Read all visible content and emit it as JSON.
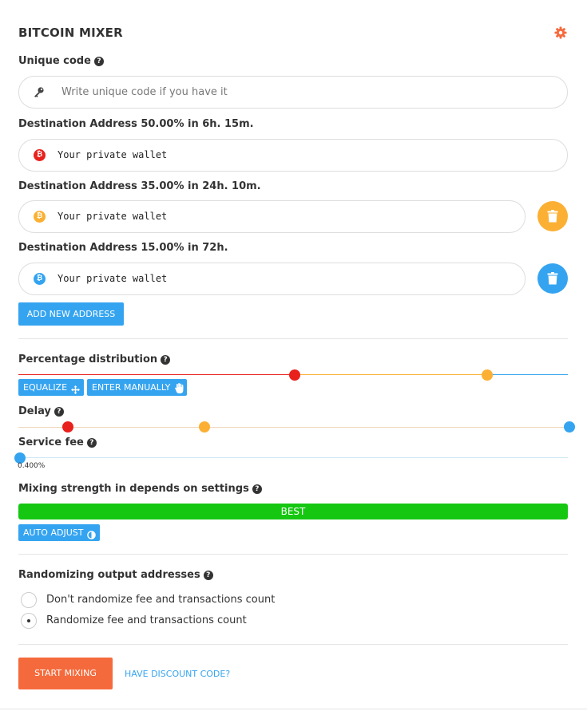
{
  "title": "BITCOIN MIXER",
  "unique_code": {
    "label": "Unique code",
    "placeholder": "Write unique code if you have it"
  },
  "addresses": [
    {
      "label": "Destination Address 50.00%  in 6h. 15m.",
      "placeholder": "Your private wallet",
      "color": "#e8211c"
    },
    {
      "label": "Destination Address 35.00%  in 24h. 10m.",
      "placeholder": "Your private wallet",
      "color": "#fbb034"
    },
    {
      "label": "Destination Address 15.00%  in 72h.",
      "placeholder": "Your private wallet",
      "color": "#35a4f0"
    }
  ],
  "add_address_label": "ADD NEW ADDRESS",
  "distribution": {
    "label": "Percentage distribution",
    "equalize_label": "EQUALIZE",
    "manual_label": "ENTER MANUALLY",
    "percentages": [
      50.0,
      35.0,
      15.0
    ]
  },
  "delay": {
    "label": "Delay"
  },
  "service_fee": {
    "label": "Service fee",
    "value": "0.400%"
  },
  "strength": {
    "label": "Mixing strength in depends on settings",
    "value": "BEST",
    "auto_adjust_label": "AUTO ADJUST"
  },
  "randomizing": {
    "label": "Randomizing output addresses",
    "options": [
      {
        "label": "Don't randomize fee and transactions count",
        "selected": false
      },
      {
        "label": "Randomize fee and transactions count",
        "selected": true
      }
    ]
  },
  "start_label": "START MIXING",
  "discount_label": "HAVE DISCOUNT CODE?",
  "colors": {
    "accent_blue": "#35a4f0",
    "accent_orange": "#f56a3c",
    "red": "#e8211c",
    "yellow": "#fbb034",
    "green": "#16c712"
  },
  "icons": {
    "settings": "gear-icon",
    "key": "key-icon",
    "coin": "bitcoin-icon",
    "delete": "trash-icon",
    "equalize": "move-arrows-icon",
    "manual": "hand-icon",
    "auto": "half-circle-icon"
  }
}
